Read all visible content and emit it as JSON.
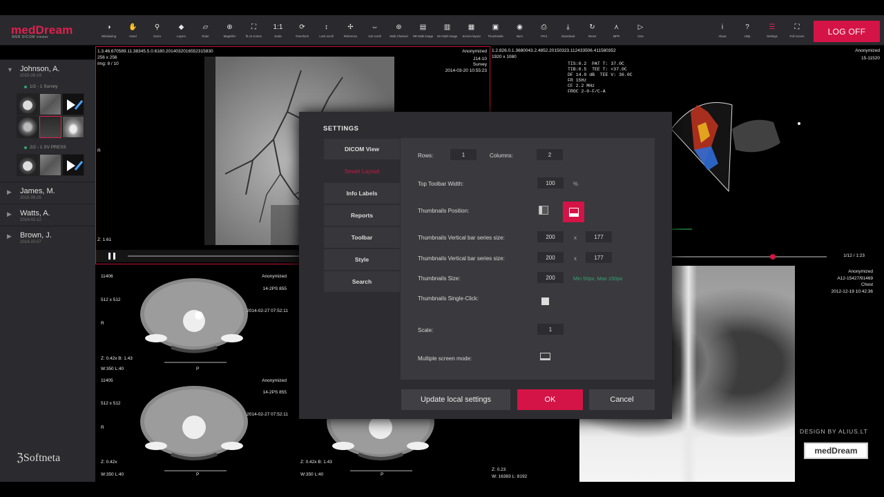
{
  "app": {
    "logo": "medDream",
    "logo_sub": "WEB DICOM viewer",
    "brand_footer": "Softneta",
    "design_by": "DESIGN BY ALIUS.LT",
    "brand_badge": "medDream"
  },
  "colors": {
    "accent": "#d41446",
    "toolbar_bg": "#2a2a2e",
    "sidebar_bg": "#2b2b2f",
    "hint_green": "#2fa86d"
  },
  "toolbar": {
    "tools": [
      {
        "label": "Windowing",
        "icon": "contrast-icon",
        "glyph": "◑"
      },
      {
        "label": "Hand",
        "icon": "hand-icon",
        "glyph": "✋"
      },
      {
        "label": "Zoom",
        "icon": "zoom-icon",
        "glyph": "⚲"
      },
      {
        "label": "Layers",
        "icon": "layers-icon",
        "glyph": "◆"
      },
      {
        "label": "Ruler",
        "icon": "ruler-icon",
        "glyph": "▱"
      },
      {
        "label": "Magnifier",
        "icon": "magnifier-icon",
        "glyph": "⊕"
      },
      {
        "label": "fit on screen",
        "icon": "fit-icon",
        "glyph": "⛶"
      },
      {
        "label": "Scale",
        "icon": "scale-icon",
        "glyph": "1:1"
      },
      {
        "label": "Transform",
        "icon": "transform-icon",
        "glyph": "⟳"
      },
      {
        "label": "Lock scroll",
        "icon": "lock-scroll-icon",
        "glyph": "↕"
      },
      {
        "label": "Reference",
        "icon": "reference-icon",
        "glyph": "✢"
      },
      {
        "label": "Get scroll",
        "icon": "get-scroll-icon",
        "glyph": "⇔"
      },
      {
        "label": "Multi Channel",
        "icon": "multi-channel-icon",
        "glyph": "⊛"
      },
      {
        "label": "NR Multi image",
        "icon": "multi-image-icon",
        "glyph": "▤"
      },
      {
        "label": "GH Multi image",
        "icon": "multi-image-2-icon",
        "glyph": "▥"
      },
      {
        "label": "Screen layout",
        "icon": "grid-icon",
        "glyph": "▦"
      },
      {
        "label": "Thumbnails",
        "icon": "thumbnails-icon",
        "glyph": "▣"
      },
      {
        "label": "Burn",
        "icon": "burn-icon",
        "glyph": "◉"
      },
      {
        "label": "Print",
        "icon": "print-icon",
        "glyph": "⎙"
      },
      {
        "label": "Download",
        "icon": "download-icon",
        "glyph": "⤓"
      },
      {
        "label": "Reset",
        "icon": "reset-icon",
        "glyph": "↻"
      },
      {
        "label": "MPR",
        "icon": "mpr-icon",
        "glyph": "⋏"
      },
      {
        "label": "Cine",
        "icon": "play-icon",
        "glyph": "▷"
      }
    ],
    "right_tools": [
      {
        "label": "About",
        "icon": "info-icon",
        "glyph": "i"
      },
      {
        "label": "Help",
        "icon": "help-icon",
        "glyph": "?"
      },
      {
        "label": "Settings",
        "icon": "settings-icon",
        "glyph": "☰"
      },
      {
        "label": "Full screen",
        "icon": "fullscreen-icon",
        "glyph": "⛶"
      }
    ],
    "logoff": "LOG OFF"
  },
  "sidebar": {
    "patients": [
      {
        "name": "Johnson, A.",
        "date": "2015-09-19"
      },
      {
        "name": "James, M.",
        "date": "2015-09-25"
      },
      {
        "name": "Watts, A.",
        "date": "2014-02-12"
      },
      {
        "name": "Brown, J.",
        "date": "2014-10-07"
      }
    ],
    "series": [
      "1/2 - 1 Survey",
      "2/2 - 1 SV PRESS"
    ]
  },
  "viewports": {
    "angio": {
      "uid": "1.3.46.670589.11.38345.5.0.6180.2014032016552315830",
      "size": "256 x 256",
      "img": "Img: 8 / 10",
      "anon": "Anonymized",
      "id": "J14-10",
      "desc": "Survey",
      "date": "2014-03-20 10:55:23",
      "side": "R",
      "zoom": "Z: 1.61"
    },
    "echo": {
      "uid": "1.2.826.0.1.3680043.2.4852.20150323.112433506.411580352",
      "size": "1920 x 1080",
      "anon": "Anonymized",
      "id": "15-11520",
      "params": "TIS:0.2  PAT T: 37.0C\nTIB:0.5  TEE T: <37.0C\nDF 14.0 dB  TEE V: 36.0C\nFR 15Hz\nCF 2.2 MHz\nFROC 2-0-F/C-A",
      "frame": "1/12 / 1:23",
      "zoom": "Z: 0.23",
      "wl": "W: 16383 L: 8192"
    },
    "ct1": {
      "id": "11406",
      "size": "512 x 512",
      "anon": "Anonymized",
      "code": "14-2PS 855",
      "date": "2014-02-27 07:52:11",
      "side": "R",
      "zoom": "Z: 0.42x  B: 1.43",
      "wl": "W:350 L:40",
      "bottom": "P"
    },
    "ct2": {
      "id": "11405",
      "size": "512 x 512",
      "anon": "Anonymized",
      "code": "14-2PS 855",
      "date": "2014-02-27 07:52:11",
      "side": "R",
      "zoom": "Z: 0.42x",
      "wl": "W:350 L:40",
      "bottom": "P"
    },
    "ct3": {
      "zoom": "Z: 0.42x  B: 1.43",
      "wl": "W:350 L:40",
      "bottom": "P"
    },
    "chest": {
      "anon": "Anonymized",
      "id": "A12-15427/91469",
      "desc": "Chest",
      "date": "2012-12-19 10:42:36"
    }
  },
  "settings": {
    "title": "SETTINGS",
    "nav": [
      "DICOM View",
      "Smart Layout",
      "Info Labels",
      "Reports",
      "Toolbar",
      "Style",
      "Search"
    ],
    "rows_label": "Rows:",
    "rows": "1",
    "columns_label": "Columns:",
    "columns": "2",
    "top_toolbar_width_label": "Top Toolbar Width:",
    "top_toolbar_width": "100",
    "percent": "%",
    "thumb_position_label": "Thumbnails Position:",
    "thumb_vbar1_label": "Thumbnails Vertical bar series size:",
    "thumb_vbar1_w": "200",
    "thumb_vbar1_h": "177",
    "thumb_vbar2_label": "Thumbnails Vertical bar series size:",
    "thumb_vbar2_w": "200",
    "thumb_vbar2_h": "177",
    "x": "x",
    "thumb_size_label": "Thumbnails Size:",
    "thumb_size": "200",
    "thumb_size_hint": "Min 50px, Max 150px",
    "thumb_single_click_label": "Thumbnails Single-Click:",
    "scale_label": "Scale:",
    "scale": "1",
    "multi_screen_label": "Multiple screen mode:",
    "update_btn": "Update local settings",
    "ok_btn": "OK",
    "cancel_btn": "Cancel"
  }
}
